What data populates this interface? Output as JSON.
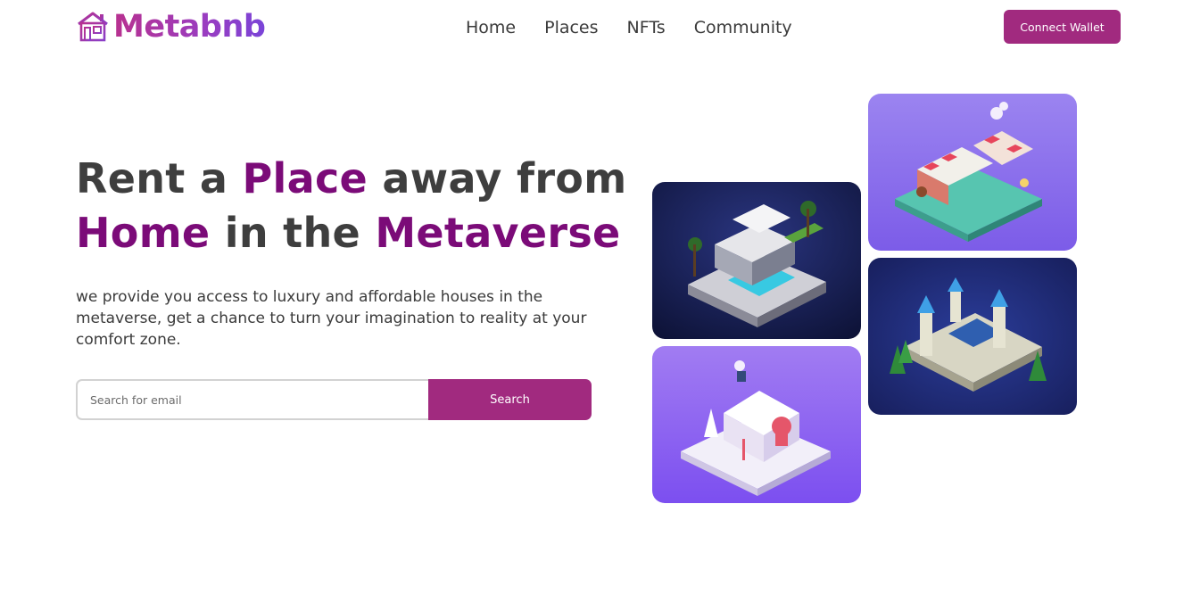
{
  "brand": {
    "name": "Metabnb",
    "logo_icon": "house-icon"
  },
  "nav": {
    "items": [
      {
        "label": "Home"
      },
      {
        "label": "Places"
      },
      {
        "label": "NFTs"
      },
      {
        "label": "Community"
      }
    ]
  },
  "header": {
    "connect_label": "Connect Wallet"
  },
  "hero": {
    "title": {
      "part1": "Rent a ",
      "accent1": "Place",
      "part2": " away from",
      "accent2": "Home",
      "part3": " in the ",
      "accent3": "Metaverse"
    },
    "description": "we provide you access to luxury and affordable houses in the metaverse, get a chance to turn your imagination to reality at your comfort zone.",
    "search_placeholder": "Search for email",
    "search_label": "Search"
  },
  "gallery": {
    "images": [
      {
        "subject": "modern-villa-pool"
      },
      {
        "subject": "market-stall-scene"
      },
      {
        "subject": "snowy-cottage"
      },
      {
        "subject": "castle-fortress"
      }
    ]
  },
  "colors": {
    "accent": "#a12a7f",
    "accent_text": "#7b0b78",
    "text": "#3e3e3e"
  }
}
